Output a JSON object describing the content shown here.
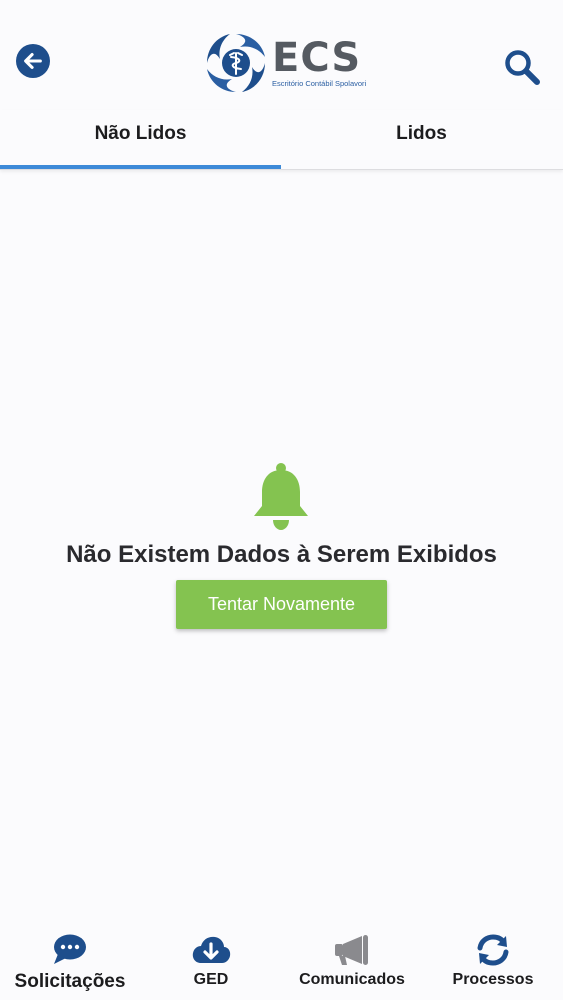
{
  "header": {
    "back_icon": "arrow-left-icon",
    "search_icon": "search-icon",
    "logo": {
      "title": "ECS",
      "subtitle": "Escritório Contábil Spolavori"
    }
  },
  "tabs": [
    {
      "label": "Não Lidos",
      "active": true
    },
    {
      "label": "Lidos",
      "active": false
    }
  ],
  "empty_state": {
    "icon": "bell-icon",
    "message": "Não Existem Dados à Serem Exibidos",
    "retry_label": "Tentar Novamente"
  },
  "bottom_nav": [
    {
      "label": "Solicitações",
      "icon": "chat-icon",
      "active": true
    },
    {
      "label": "GED",
      "icon": "cloud-download-icon",
      "active": false
    },
    {
      "label": "Comunicados",
      "icon": "megaphone-icon",
      "active": false
    },
    {
      "label": "Processos",
      "icon": "refresh-icon",
      "active": false
    }
  ],
  "colors": {
    "primary": "#1e4e8c",
    "accent": "#3d8ad8",
    "success": "#84c350",
    "muted_icon": "#8a8a8e"
  }
}
